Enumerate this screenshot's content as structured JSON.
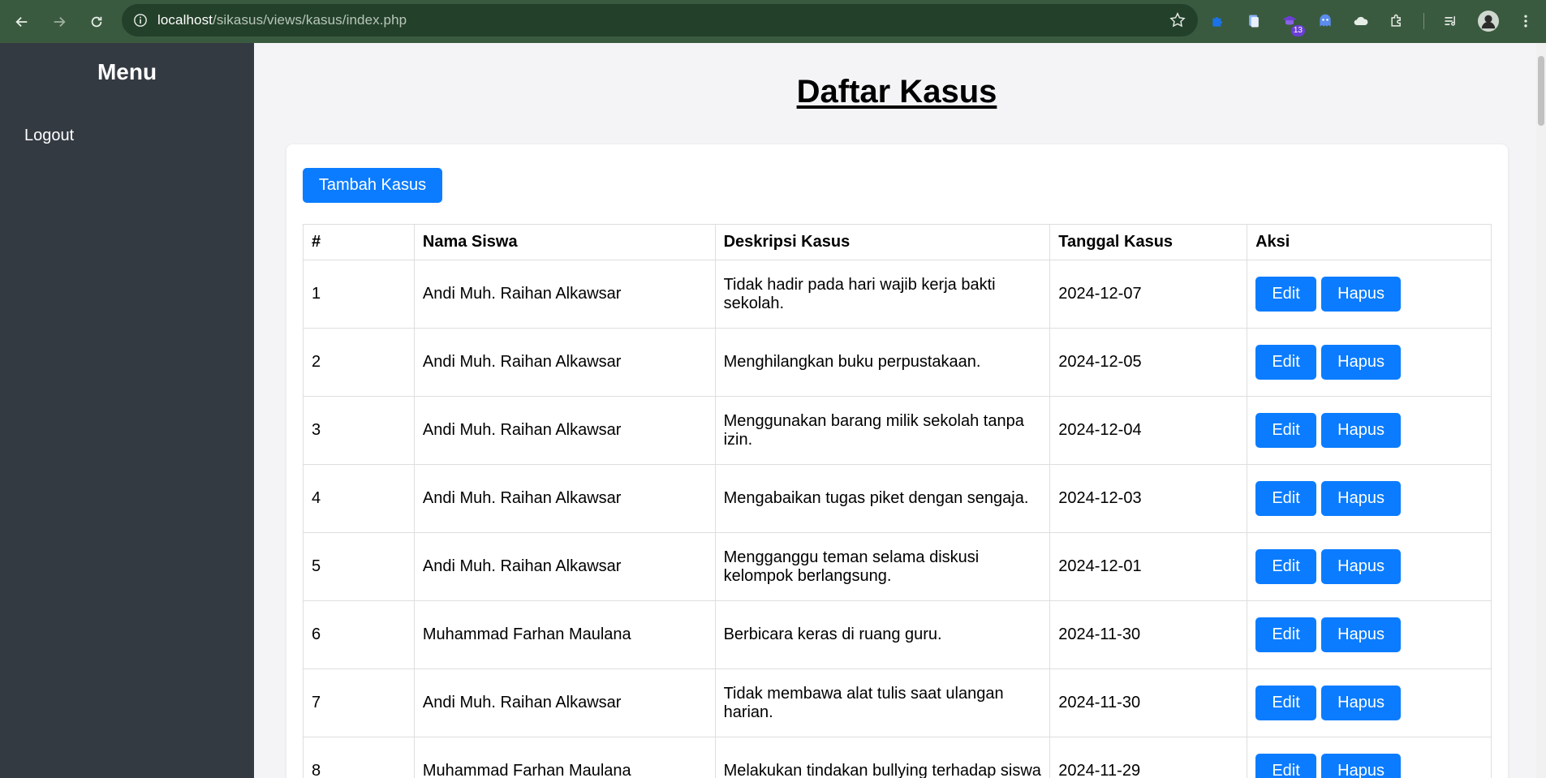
{
  "browser": {
    "url_host": "localhost",
    "url_path": "/sikasus/views/kasus/index.php",
    "extension_badge": "13",
    "icons": [
      "back-icon",
      "forward-icon",
      "reload-icon",
      "site-info-icon",
      "bookmark-star-icon",
      "puzzle-extension-icon",
      "document-extension-icon",
      "graduation-extension-icon",
      "ghost-extension-icon",
      "cloud-extension-icon",
      "extensions-icon",
      "media-control-icon",
      "profile-avatar",
      "menu-kebab-icon"
    ]
  },
  "sidebar": {
    "title": "Menu",
    "links": [
      {
        "label": "Logout"
      }
    ]
  },
  "main": {
    "title": "Daftar Kasus",
    "add_button": "Tambah Kasus",
    "table": {
      "headers": [
        "#",
        "Nama Siswa",
        "Deskripsi Kasus",
        "Tanggal Kasus",
        "Aksi"
      ],
      "rows": [
        {
          "no": "1",
          "name": "Andi Muh. Raihan Alkawsar",
          "desc": "Tidak hadir pada hari wajib kerja bakti sekolah.",
          "date": "2024-12-07"
        },
        {
          "no": "2",
          "name": "Andi Muh. Raihan Alkawsar",
          "desc": "Menghilangkan buku perpustakaan.",
          "date": "2024-12-05"
        },
        {
          "no": "3",
          "name": "Andi Muh. Raihan Alkawsar",
          "desc": "Menggunakan barang milik sekolah tanpa izin.",
          "date": "2024-12-04"
        },
        {
          "no": "4",
          "name": "Andi Muh. Raihan Alkawsar",
          "desc": "Mengabaikan tugas piket dengan sengaja.",
          "date": "2024-12-03"
        },
        {
          "no": "5",
          "name": "Andi Muh. Raihan Alkawsar",
          "desc": "Mengganggu teman selama diskusi kelompok berlangsung.",
          "date": "2024-12-01"
        },
        {
          "no": "6",
          "name": "Muhammad Farhan Maulana",
          "desc": "Berbicara keras di ruang guru.",
          "date": "2024-11-30"
        },
        {
          "no": "7",
          "name": "Andi Muh. Raihan Alkawsar",
          "desc": "Tidak membawa alat tulis saat ulangan harian.",
          "date": "2024-11-30"
        },
        {
          "no": "8",
          "name": "Muhammad Farhan Maulana",
          "desc": "Melakukan tindakan bullying terhadap siswa",
          "date": "2024-11-29"
        }
      ],
      "edit_label": "Edit",
      "delete_label": "Hapus"
    }
  },
  "colors": {
    "chrome": "#3a5a3f",
    "sidebar": "#343a42",
    "primary_button": "#0b7cff"
  }
}
